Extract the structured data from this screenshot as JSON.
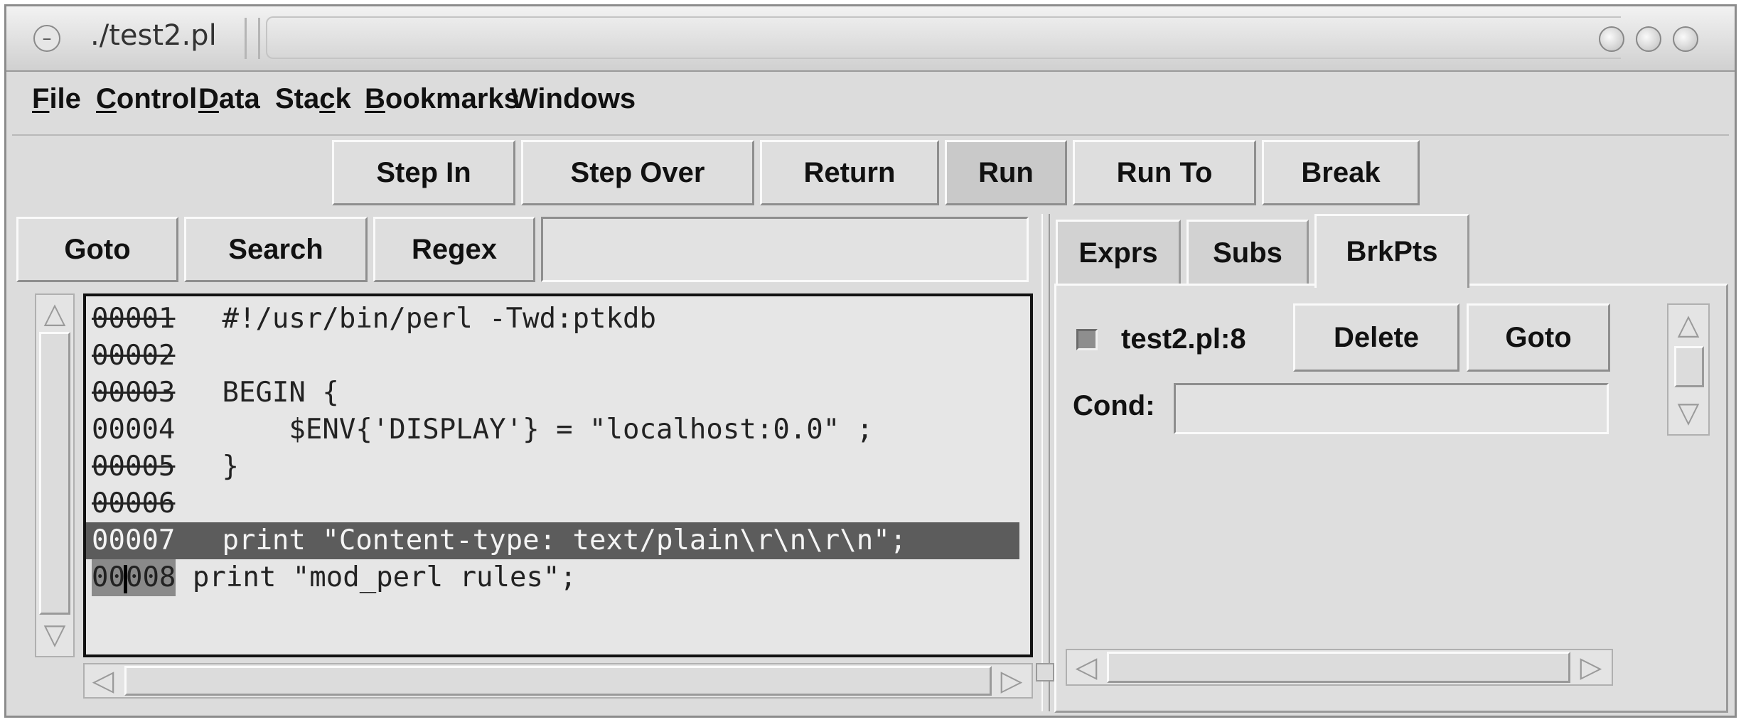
{
  "window": {
    "title": "./test2.pl"
  },
  "menu": [
    {
      "label": "File",
      "mnemonic": 0
    },
    {
      "label": "Control",
      "mnemonic": 0
    },
    {
      "label": "Data",
      "mnemonic": 0
    },
    {
      "label": "Stack",
      "mnemonic": 3
    },
    {
      "label": "Bookmarks",
      "mnemonic": 0
    },
    {
      "label": "Windows",
      "mnemonic": -1
    }
  ],
  "toolbar": {
    "step_in": "Step In",
    "step_over": "Step Over",
    "return": "Return",
    "run": "Run",
    "run_to": "Run To",
    "break": "Break"
  },
  "search": {
    "goto": "Goto",
    "search": "Search",
    "regex": "Regex",
    "entry_value": ""
  },
  "code": [
    {
      "num": "00001",
      "text": " #!/usr/bin/perl -Twd:ptkdb",
      "breakable": true
    },
    {
      "num": "00002",
      "text": "",
      "breakable": true
    },
    {
      "num": "00003",
      "text": " BEGIN {",
      "breakable": true
    },
    {
      "num": "00004",
      "text": "     $ENV{'DISPLAY'} = \"localhost:0.0\" ;",
      "breakable": false
    },
    {
      "num": "00005",
      "text": " }",
      "breakable": true
    },
    {
      "num": "00006",
      "text": "",
      "breakable": true
    },
    {
      "num": "00007",
      "text": " print \"Content-type: text/plain\\r\\n\\r\\n\";",
      "breakable": false,
      "highlighted": true
    },
    {
      "num": "00008",
      "text": " print \"mod_perl rules\";",
      "breakable": false,
      "current": true
    }
  ],
  "tabs": [
    "Exprs",
    "Subs",
    "BrkPts"
  ],
  "selected_tab": "BrkPts",
  "breakpoint": {
    "location": "test2.pl:8",
    "delete": "Delete",
    "goto": "Goto",
    "cond_label": "Cond:",
    "cond_value": ""
  }
}
